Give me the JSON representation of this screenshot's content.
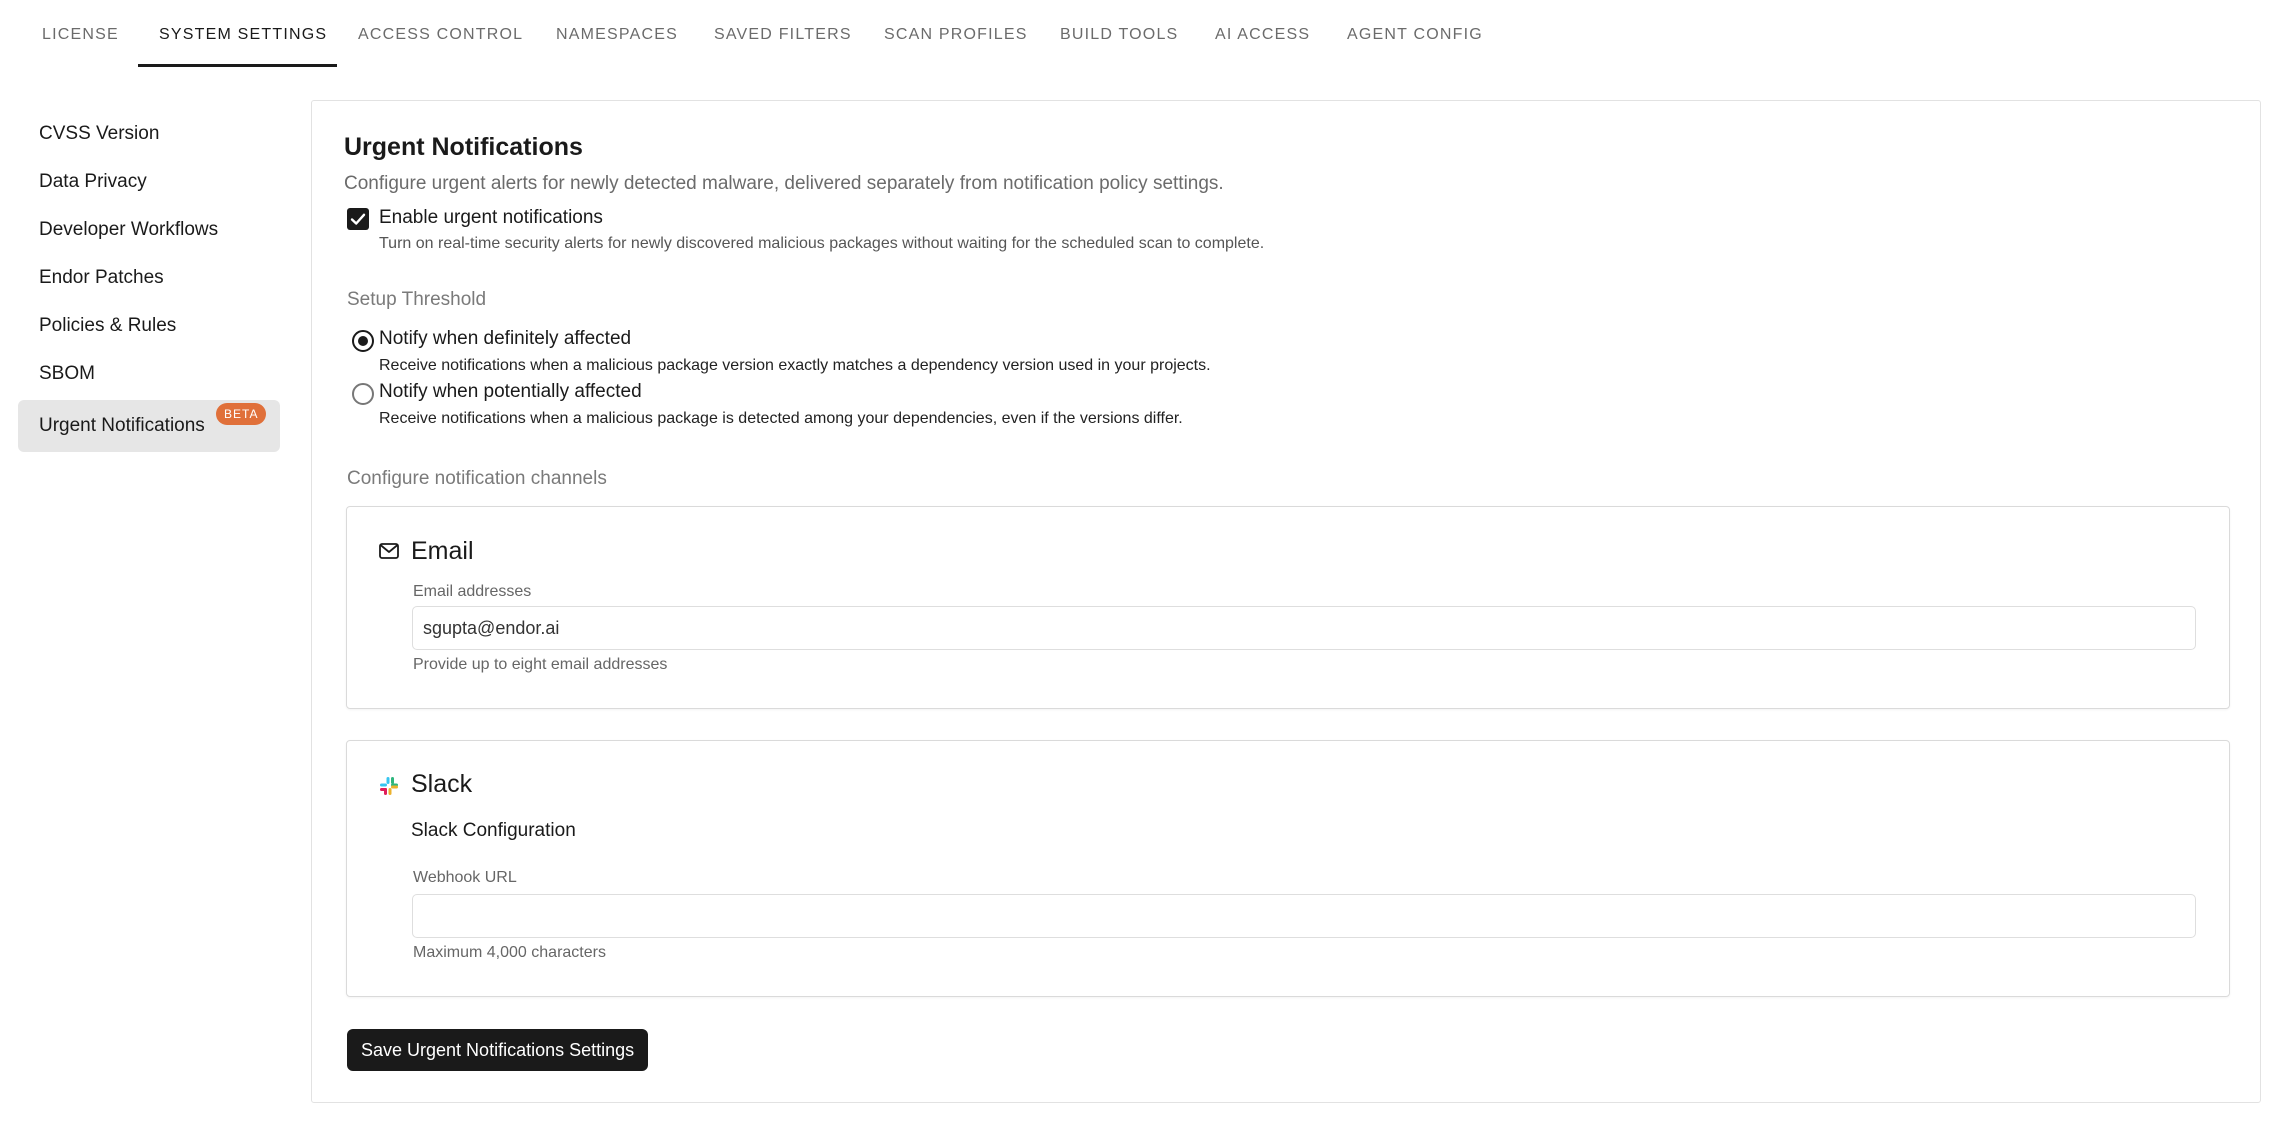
{
  "tabs": [
    {
      "label": "LICENSE"
    },
    {
      "label": "SYSTEM SETTINGS"
    },
    {
      "label": "ACCESS CONTROL"
    },
    {
      "label": "NAMESPACES"
    },
    {
      "label": "SAVED FILTERS"
    },
    {
      "label": "SCAN PROFILES"
    },
    {
      "label": "BUILD TOOLS"
    },
    {
      "label": "AI ACCESS"
    },
    {
      "label": "AGENT CONFIG"
    }
  ],
  "active_tab": "SYSTEM SETTINGS",
  "sidebar": {
    "items": [
      {
        "label": "CVSS Version"
      },
      {
        "label": "Data Privacy"
      },
      {
        "label": "Developer Workflows"
      },
      {
        "label": "Endor Patches"
      },
      {
        "label": "Policies & Rules"
      },
      {
        "label": "SBOM"
      },
      {
        "label": "Urgent Notifications",
        "badge": "BETA"
      }
    ],
    "active": "Urgent Notifications"
  },
  "main": {
    "title": "Urgent Notifications",
    "subtitle": "Configure urgent alerts for newly detected malware, delivered separately from notification policy settings.",
    "enable": {
      "label": "Enable urgent notifications",
      "description": "Turn on real-time security alerts for newly discovered malicious packages without waiting for the scheduled scan to complete.",
      "checked": true
    },
    "threshold": {
      "label": "Setup Threshold",
      "options": [
        {
          "label": "Notify when definitely affected",
          "description": "Receive notifications when a malicious package version exactly matches a dependency version used in your projects.",
          "selected": true
        },
        {
          "label": "Notify when potentially affected",
          "description": "Receive notifications when a malicious package is detected among your dependencies, even if the versions differ.",
          "selected": false
        }
      ]
    },
    "channels_label": "Configure notification channels",
    "email": {
      "title": "Email",
      "field_label": "Email addresses",
      "value": "sgupta@endor.ai",
      "helper": "Provide up to eight email addresses"
    },
    "slack": {
      "title": "Slack",
      "config_label": "Slack Configuration",
      "field_label": "Webhook URL",
      "value": "",
      "helper": "Maximum 4,000 characters"
    },
    "save_label": "Save Urgent Notifications Settings"
  },
  "colors": {
    "accent": "#1a1a1a",
    "beta_badge": "#e0703a",
    "active_sidebar_bg": "#e6e6e6",
    "slack_red": "#e01e5a",
    "slack_blue": "#36c5f0",
    "slack_green": "#2eb67d",
    "slack_yellow": "#ecb22e"
  }
}
